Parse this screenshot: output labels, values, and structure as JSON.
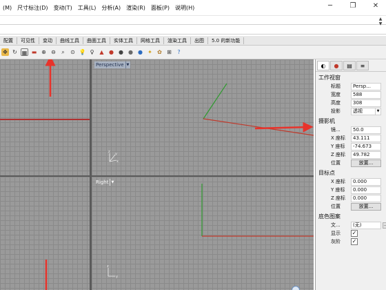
{
  "menubar": {
    "items": [
      "(M)",
      "尺寸标注(D)",
      "变动(T)",
      "工具(L)",
      "分析(A)",
      "渲染(R)",
      "面板(P)",
      "说明(H)"
    ]
  },
  "window_controls": {
    "minimize": "─",
    "restore": "❐",
    "close": "✕"
  },
  "tabs": [
    "配置",
    "可见性",
    "变动",
    "曲线工具",
    "曲面工具",
    "实体工具",
    "网格工具",
    "渲染工具",
    "出图",
    "5.0 的新功能"
  ],
  "viewports": {
    "perspective": {
      "label": "Perspective"
    },
    "right": {
      "label": "Right"
    }
  },
  "panel": {
    "viewport_section": {
      "title": "工作视窗",
      "rows": [
        {
          "label": "标题",
          "value": "Persp..."
        },
        {
          "label": "宽度",
          "value": "588"
        },
        {
          "label": "高度",
          "value": "308"
        },
        {
          "label": "投影",
          "value": "透视"
        }
      ]
    },
    "camera_section": {
      "title": "摄影机",
      "rows": [
        {
          "label": "镜...",
          "value": "50.0"
        },
        {
          "label": "X 座标",
          "value": "43.111"
        },
        {
          "label": "Y 座标",
          "value": "-74.673"
        },
        {
          "label": "Z 座标",
          "value": "49.782"
        }
      ],
      "location_label": "位置",
      "place_button": "放置..."
    },
    "target_section": {
      "title": "目标点",
      "rows": [
        {
          "label": "X 座标",
          "value": "0.000"
        },
        {
          "label": "Y 座标",
          "value": "0.000"
        },
        {
          "label": "Z 座标",
          "value": "0.000"
        }
      ],
      "location_label": "位置",
      "place_button": "放置..."
    },
    "background_section": {
      "title": "底色图案",
      "file_label": "文...",
      "file_value": "(无)",
      "browse": "...",
      "show_label": "显示",
      "gray_label": "灰阶"
    }
  },
  "colors": {
    "viewport_bg": "#9a9a9a",
    "grid_line": "#8a8a8a",
    "x_axis": "#c0392b",
    "y_axis": "#2e9a2e",
    "annotation_arrow": "#e8332b"
  }
}
